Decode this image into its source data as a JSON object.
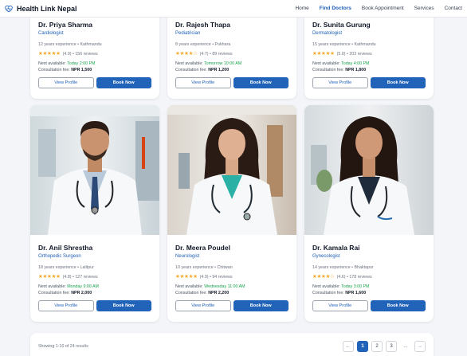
{
  "header": {
    "brand": "Health Link Nepal",
    "nav": [
      "Home",
      "Find Doctors",
      "Book Appointment",
      "Services",
      "Contact"
    ]
  },
  "labels": {
    "view_profile": "View Profile",
    "book_now": "Book Now",
    "next_available": "Next available: ",
    "consultation_fee": "Consultation fee: "
  },
  "doctors": [
    {
      "name": "Dr. Priya Sharma",
      "specialty": "Cardiologist",
      "meta": "12 years experience • Kathmandu",
      "stars": "★★★★★",
      "rating": "(4.9) • 156 reviews",
      "available": "Today 2:00 PM",
      "fee": "NPR 1,500"
    },
    {
      "name": "Dr. Rajesh Thapa",
      "specialty": "Pediatrician",
      "meta": "8 years experience • Pokhara",
      "stars": "★★★★☆",
      "rating": "(4.7) • 89 reviews",
      "available": "Tomorrow 10:00 AM",
      "fee": "NPR 1,200"
    },
    {
      "name": "Dr. Sunita Gurung",
      "specialty": "Dermatologist",
      "meta": "15 years experience • Kathmandu",
      "stars": "★★★★★",
      "rating": "(5.0) • 203 reviews",
      "available": "Today 4:00 PM",
      "fee": "NPR 1,800"
    },
    {
      "name": "Dr. Anil Shrestha",
      "specialty": "Orthopedic Surgeon",
      "meta": "18 years experience • Lalitpur",
      "stars": "★★★★★",
      "rating": "(4.8) • 127 reviews",
      "available": "Monday 9:00 AM",
      "fee": "NPR 2,000"
    },
    {
      "name": "Dr. Meera Poudel",
      "specialty": "Neurologist",
      "meta": "10 years experience • Chitwan",
      "stars": "★★★★★",
      "rating": "(4.9) • 94 reviews",
      "available": "Wednesday 11:00 AM",
      "fee": "NPR 2,200"
    },
    {
      "name": "Dr. Kamala Rai",
      "specialty": "Gynecologist",
      "meta": "14 years experience • Bhaktapur",
      "stars": "★★★★☆",
      "rating": "(4.6) • 178 reviews",
      "available": "Today 3:00 PM",
      "fee": "NPR 1,600"
    }
  ],
  "pagination": {
    "showing": "Showing 1-10 of 24 results",
    "prev_icon": "←",
    "pages": [
      "1",
      "2",
      "3"
    ],
    "ellipsis": "...",
    "next_icon": "→"
  }
}
